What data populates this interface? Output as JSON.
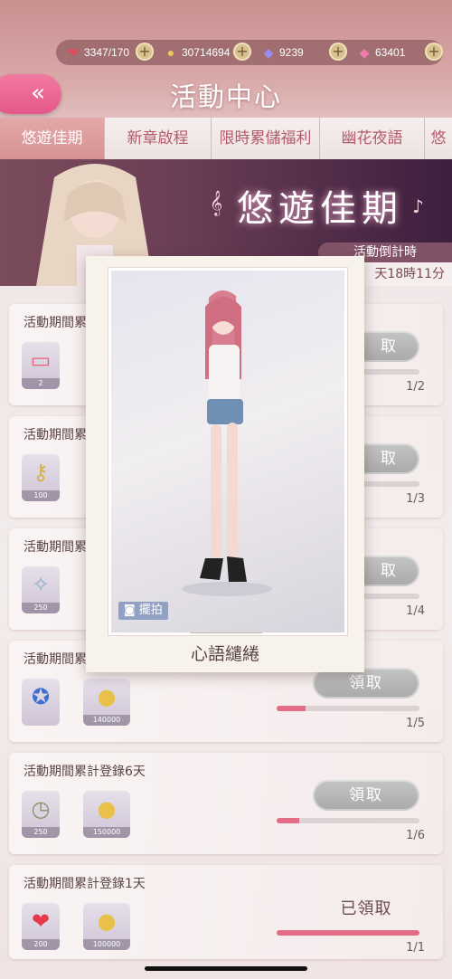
{
  "resources": [
    {
      "icon": "heart-icon",
      "value": "3347/170"
    },
    {
      "icon": "cat-coin-icon",
      "value": "30714694"
    },
    {
      "icon": "blue-diamond-icon",
      "value": "9239"
    },
    {
      "icon": "pink-diamond-icon",
      "value": "63401"
    }
  ],
  "header": {
    "back_label": "«",
    "title": "活動中心"
  },
  "tabs": [
    {
      "label": "悠遊佳期",
      "active": true
    },
    {
      "label": "新章啟程"
    },
    {
      "label": "限時累儲福利"
    },
    {
      "label": "幽花夜語"
    },
    {
      "label": "悠"
    }
  ],
  "banner": {
    "title": "悠遊佳期",
    "countdown_label": "活動倒計時",
    "countdown_value": "天18時11分"
  },
  "tasks": [
    {
      "title": "活動期間累",
      "items": [
        {
          "icon": "ticket-icon",
          "qty": "2"
        }
      ],
      "button": "取",
      "progress": "1/2",
      "fill": 0
    },
    {
      "title": "活動期間累",
      "items": [
        {
          "icon": "key-icon",
          "qty": "100"
        }
      ],
      "button": "取",
      "progress": "1/3",
      "fill": 0
    },
    {
      "title": "活動期間累",
      "items": [
        {
          "icon": "wand-icon",
          "qty": "250"
        }
      ],
      "button": "取",
      "progress": "1/4",
      "fill": 0
    },
    {
      "title": "活動期間累",
      "items": [
        {
          "icon": "badge-icon",
          "qty": ""
        },
        {
          "icon": "cat-coin-icon",
          "qty": "140000"
        }
      ],
      "button": "領取",
      "progress": "1/5",
      "fill": 0.2
    },
    {
      "title": "活動期間累計登錄6天",
      "items": [
        {
          "icon": "clock-icon",
          "qty": "250"
        },
        {
          "icon": "cat-coin-icon",
          "qty": "150000"
        }
      ],
      "button": "領取",
      "progress": "1/6",
      "fill": 0.16
    },
    {
      "title": "活動期間累計登錄1天",
      "items": [
        {
          "icon": "heart-icon",
          "qty": "200"
        },
        {
          "icon": "cat-coin-icon",
          "qty": "100000"
        }
      ],
      "button": "已領取",
      "progress": "1/1",
      "fill": 1.0
    }
  ],
  "popup": {
    "camera_label": "擺拍",
    "name": "心語繾綣"
  },
  "colors": {
    "accent": "#e5578a",
    "tab_active": "#d69293",
    "progress_fill": "#e36c86"
  }
}
